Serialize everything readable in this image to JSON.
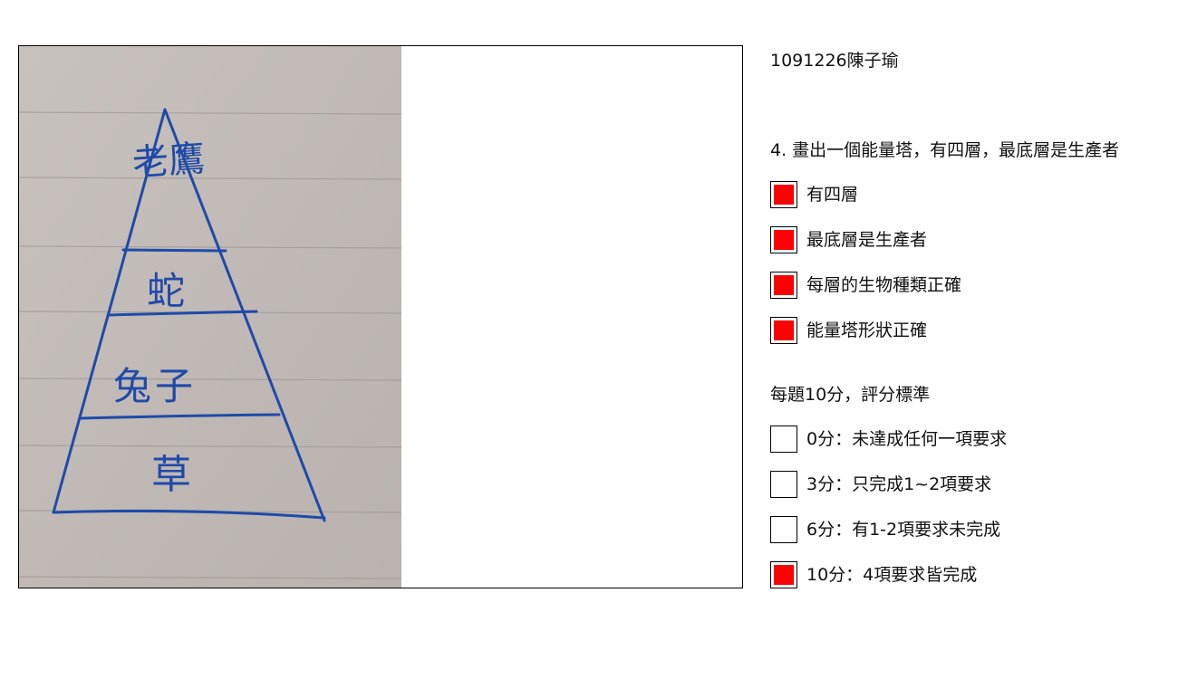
{
  "student_id": "1091226陳子瑜",
  "question": "4. 畫出一個能量塔，有四層，最底層是生產者",
  "drawing": {
    "tiers": [
      "老鷹",
      "蛇",
      "兔子",
      "草"
    ],
    "ink_color": "#1f4aa8",
    "paper_color": "#c3bcb8"
  },
  "requirements": [
    {
      "label": "有四層",
      "checked": true
    },
    {
      "label": "最底層是生產者",
      "checked": true
    },
    {
      "label": "每層的生物種類正確",
      "checked": true
    },
    {
      "label": "能量塔形狀正確",
      "checked": true
    }
  ],
  "scoring": {
    "title": "每題10分，評分標準",
    "options": [
      {
        "label": "0分：未達成任何一項要求",
        "checked": false
      },
      {
        "label": "3分：只完成1~2項要求",
        "checked": false
      },
      {
        "label": "6分：有1-2項要求未完成",
        "checked": false
      },
      {
        "label": "10分：4項要求皆完成",
        "checked": true
      }
    ]
  },
  "colors": {
    "checked_fill": "#ff0000"
  }
}
